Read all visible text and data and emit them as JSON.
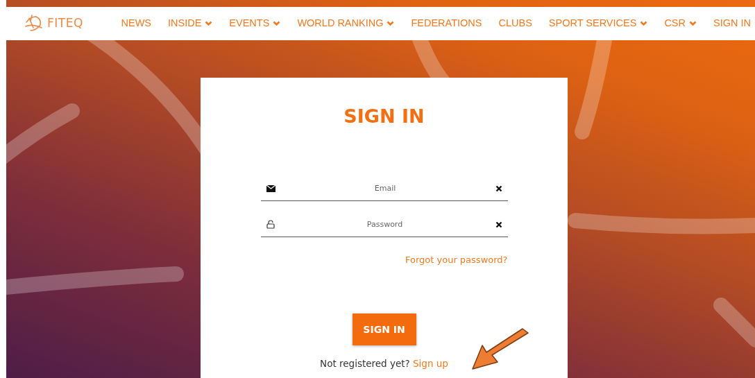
{
  "logo": {
    "text": "FITEQ"
  },
  "nav": [
    {
      "label": "NEWS",
      "dropdown": false
    },
    {
      "label": "INSIDE",
      "dropdown": true
    },
    {
      "label": "EVENTS",
      "dropdown": true
    },
    {
      "label": "WORLD RANKING",
      "dropdown": true
    },
    {
      "label": "FEDERATIONS",
      "dropdown": false
    },
    {
      "label": "CLUBS",
      "dropdown": false
    },
    {
      "label": "SPORT SERVICES",
      "dropdown": true
    },
    {
      "label": "CSR",
      "dropdown": true
    },
    {
      "label": "SIGN IN",
      "dropdown": false
    }
  ],
  "form": {
    "title": "SIGN IN",
    "fields": [
      {
        "kind": "email",
        "placeholder": "Email"
      },
      {
        "kind": "password",
        "placeholder": "Password"
      }
    ],
    "forgot_link": "Forgot your password?",
    "submit": "SIGN IN",
    "signup_prompt": "Not registered yet?",
    "signup_link": "Sign up"
  }
}
